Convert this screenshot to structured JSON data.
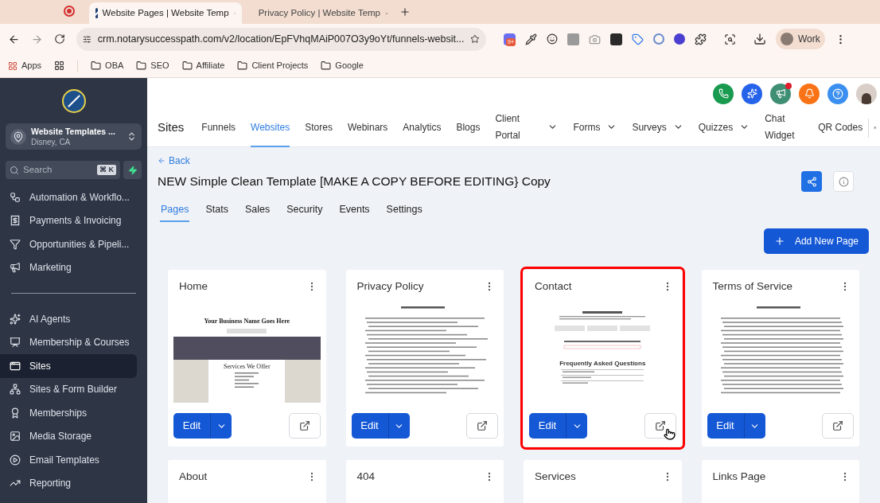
{
  "browser": {
    "tabs": [
      {
        "title": "Website Pages | Website Temp",
        "selected": true
      },
      {
        "title": "Privacy Policy | Website Temp",
        "selected": false
      }
    ],
    "url": "crm.notarysuccesspath.com/v2/location/EpFVhqMAiP007O3y9oYt/funnels-websit...",
    "extension_badge": "9+",
    "profile": "Work",
    "bookmarks": [
      "Apps",
      "OBA",
      "SEO",
      "Affiliate",
      "Client Projects",
      "Google"
    ]
  },
  "sidebar": {
    "account": {
      "name": "Website Templates ...",
      "location": "Disney, CA"
    },
    "search": {
      "placeholder": "Search",
      "shortcut": "⌘ K"
    },
    "groups": [
      [
        {
          "label": "Automation & Workflo...",
          "selected": false
        },
        {
          "label": "Payments & Invoicing",
          "selected": false
        },
        {
          "label": "Opportunities & Pipeli...",
          "selected": false
        },
        {
          "label": "Marketing",
          "selected": false
        }
      ],
      [
        {
          "label": "AI Agents",
          "selected": false
        },
        {
          "label": "Membership & Courses",
          "selected": false
        },
        {
          "label": "Sites",
          "selected": true
        },
        {
          "label": "Sites & Form Builder",
          "selected": false
        },
        {
          "label": "Memberships",
          "selected": false
        },
        {
          "label": "Media Storage",
          "selected": false
        },
        {
          "label": "Email Templates",
          "selected": false
        },
        {
          "label": "Reporting",
          "selected": false
        }
      ]
    ]
  },
  "header": {
    "announcements_unread": true
  },
  "nav": {
    "title": "Sites",
    "items": [
      {
        "label": "Funnels",
        "selected": false,
        "dropdown": false
      },
      {
        "label": "Websites",
        "selected": true,
        "dropdown": false
      },
      {
        "label": "Stores",
        "selected": false,
        "dropdown": false
      },
      {
        "label": "Webinars",
        "selected": false,
        "dropdown": false
      },
      {
        "label": "Analytics",
        "selected": false,
        "dropdown": false
      },
      {
        "label": "Blogs",
        "selected": false,
        "dropdown": false
      },
      {
        "label": "Client Portal",
        "selected": false,
        "dropdown": true
      },
      {
        "label": "Forms",
        "selected": false,
        "dropdown": true
      },
      {
        "label": "Surveys",
        "selected": false,
        "dropdown": true
      },
      {
        "label": "Quizzes",
        "selected": false,
        "dropdown": true
      },
      {
        "label": "Chat Widget",
        "selected": false,
        "dropdown": false
      },
      {
        "label": "QR Codes",
        "selected": false,
        "dropdown": false
      }
    ]
  },
  "site": {
    "back": "Back",
    "title": "NEW Simple Clean Template [MAKE A COPY BEFORE EDITING} Copy",
    "tabs": [
      {
        "label": "Pages",
        "selected": true
      },
      {
        "label": "Stats",
        "selected": false
      },
      {
        "label": "Sales",
        "selected": false
      },
      {
        "label": "Security",
        "selected": false
      },
      {
        "label": "Events",
        "selected": false
      },
      {
        "label": "Settings",
        "selected": false
      }
    ],
    "add_button": "Add New Page"
  },
  "pages": [
    {
      "title": "Home",
      "kind": "home",
      "headline": "Your Business Name Goes Here",
      "section": "Services We Offer",
      "edit_label": "Edit",
      "highlighted": false,
      "hovered": false
    },
    {
      "title": "Privacy Policy",
      "kind": "document",
      "edit_label": "Edit",
      "highlighted": false,
      "hovered": false
    },
    {
      "title": "Contact",
      "kind": "contact",
      "section": "Frequently Asked Questions",
      "edit_label": "Edit",
      "highlighted": true,
      "hovered": true
    },
    {
      "title": "Terms of Service",
      "kind": "document",
      "edit_label": "Edit",
      "highlighted": false,
      "hovered": false
    },
    {
      "title": "About"
    },
    {
      "title": "404"
    },
    {
      "title": "Services"
    },
    {
      "title": "Links Page"
    }
  ]
}
